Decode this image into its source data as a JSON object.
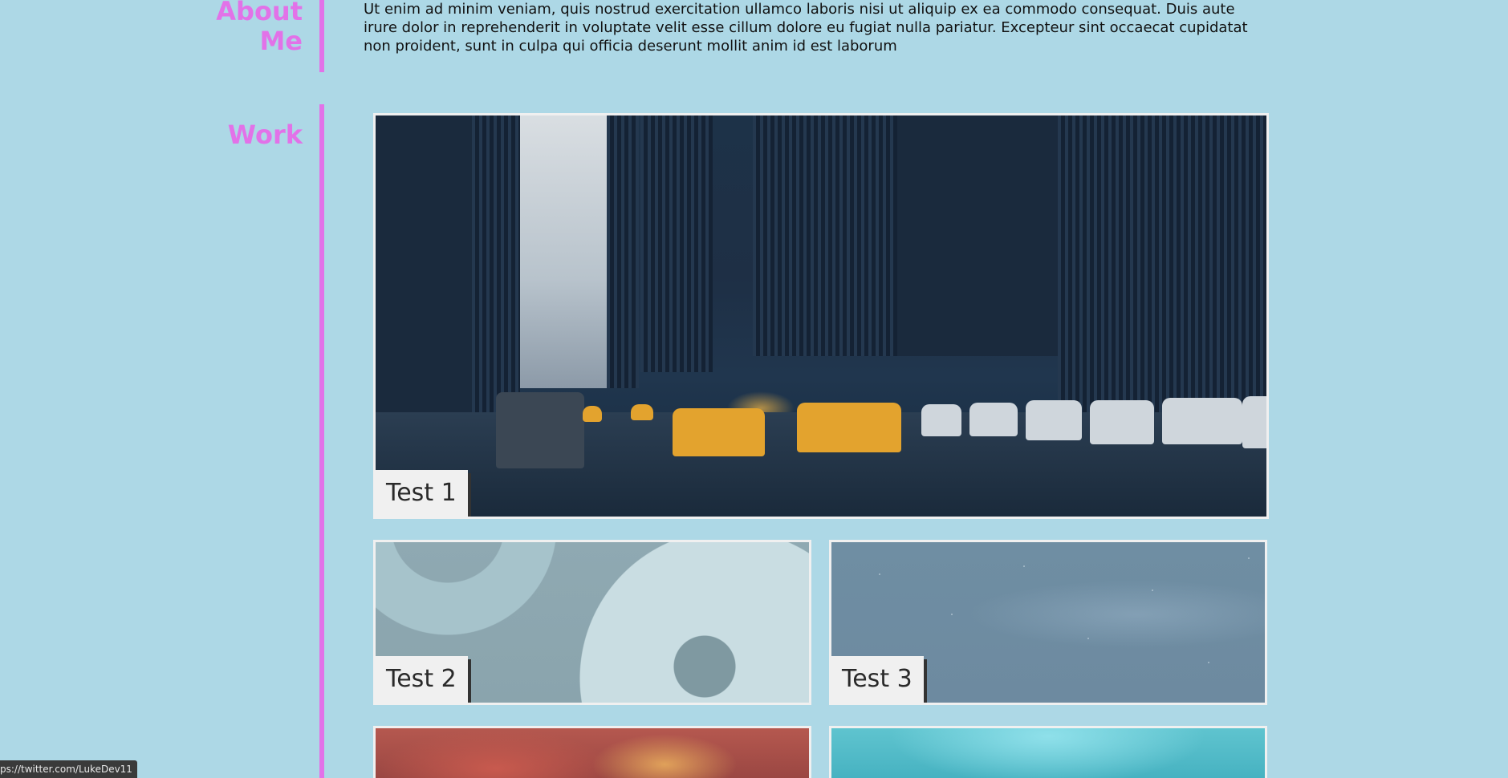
{
  "about": {
    "heading": "About Me",
    "text": "Ut enim ad minim veniam, quis nostrud exercitation ullamco laboris nisi ut aliquip ex ea commodo consequat. Duis aute irure dolor in reprehenderit in voluptate velit esse cillum dolore eu fugiat nulla pariatur. Excepteur sint occaecat cupidatat non proident, sunt in culpa qui officia deserunt mollit anim id est laborum"
  },
  "work": {
    "heading": "Work",
    "items": [
      {
        "label": "Test 1"
      },
      {
        "label": "Test 2"
      },
      {
        "label": "Test 3"
      }
    ]
  },
  "status_bar": {
    "url": "ps://twitter.com/LukeDev11"
  },
  "colors": {
    "background": "#add8e6",
    "accent": "#e272e8",
    "label_bg": "#f0f0f0"
  }
}
